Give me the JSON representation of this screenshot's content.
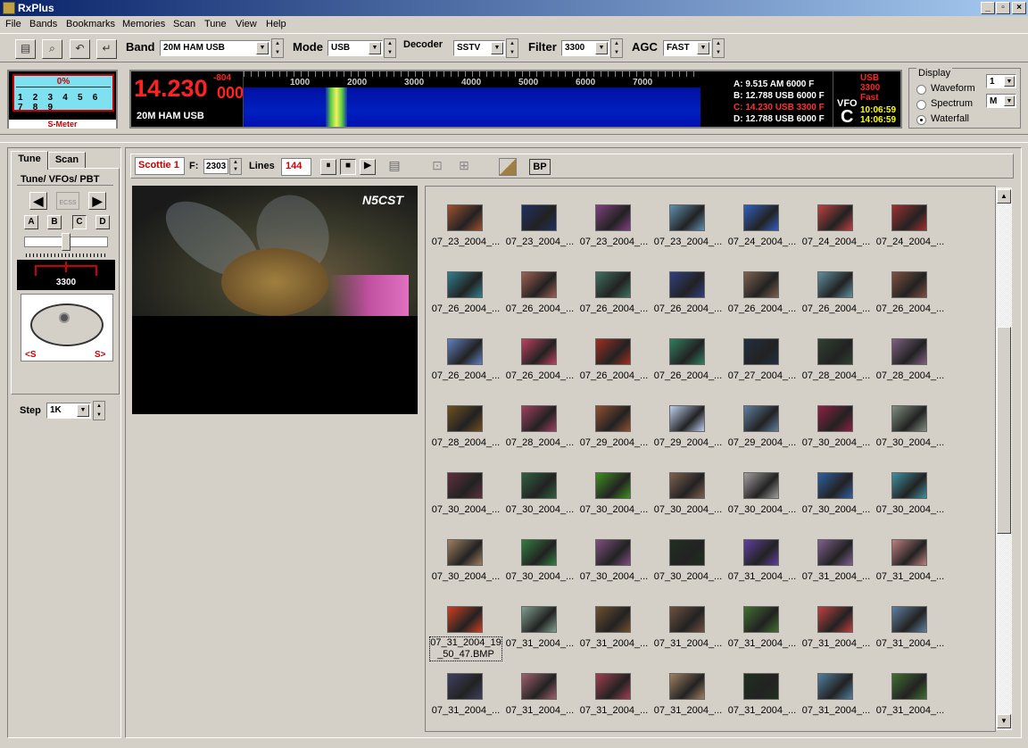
{
  "window": {
    "title": "RxPlus"
  },
  "menu": [
    "File",
    "Bands",
    "Bookmarks",
    "Memories",
    "Scan",
    "Tune",
    "View",
    "Help"
  ],
  "toolbar": {
    "band_label": "Band",
    "band_value": "20M HAM USB",
    "mode_label": "Mode",
    "mode_value": "USB",
    "decoder_label": "Decoder",
    "decoder_value": "SSTV",
    "filter_label": "Filter",
    "filter_value": "3300",
    "agc_label": "AGC",
    "agc_value": "FAST"
  },
  "smeter": {
    "percent": "0%",
    "scale": "1 2 3 4 5 6 7 8 9",
    "label": "S-Meter"
  },
  "frequency": {
    "main": "14.230",
    "sub": "000",
    "offset": "-804",
    "band": "20M HAM USB"
  },
  "spectrum": {
    "ticks": [
      "1000",
      "2000",
      "3000",
      "4000",
      "5000",
      "6000",
      "7000"
    ]
  },
  "vfos": [
    {
      "text": "A: 9.515 AM  6000 F",
      "color": "#ffffff"
    },
    {
      "text": "B: 12.788 USB 6000 F",
      "color": "#ffffff"
    },
    {
      "text": "C: 14.230 USB 3300 F",
      "color": "#ff3030"
    },
    {
      "text": "D: 12.788 USB 6000 F",
      "color": "#ffffff"
    }
  ],
  "vfo": {
    "label": "VFO",
    "letter": "C",
    "mode": "USB",
    "filter": "3300",
    "agc": "Fast",
    "time1": "10:06:59",
    "time2": "14:06:59"
  },
  "display": {
    "label": "Display",
    "options": [
      "Waveform",
      "Spectrum",
      "Waterfall"
    ],
    "selected": "Waterfall",
    "combo1": "1",
    "combo2": "M"
  },
  "tabs": {
    "tune": "Tune",
    "scan": "Scan"
  },
  "tune_panel": {
    "group_label": "Tune/ VFOs/ PBT",
    "ecss_label": "ECSS",
    "vfo_buttons": [
      "A",
      "B",
      "C",
      "D"
    ],
    "pbt_value": "3300",
    "knob_left": "<S",
    "knob_right": "S>",
    "step_label": "Step",
    "step_value": "1K"
  },
  "sstv": {
    "mode": "Scottie 1",
    "f_label": "F:",
    "f_value": "2303",
    "lines_label": "Lines",
    "lines_value": "144",
    "bp_label": "BP",
    "callsign": "N5CST"
  },
  "gallery": {
    "rows": [
      [
        "07_23_2004_...",
        "07_23_2004_...",
        "07_23_2004_...",
        "07_23_2004_...",
        "07_24_2004_...",
        "07_24_2004_...",
        "07_24_2004_..."
      ],
      [
        "07_26_2004_...",
        "07_26_2004_...",
        "07_26_2004_...",
        "07_26_2004_...",
        "07_26_2004_...",
        "07_26_2004_...",
        "07_26_2004_..."
      ],
      [
        "07_26_2004_...",
        "07_26_2004_...",
        "07_26_2004_...",
        "07_26_2004_...",
        "07_27_2004_...",
        "07_28_2004_...",
        "07_28_2004_..."
      ],
      [
        "07_28_2004_...",
        "07_28_2004_...",
        "07_29_2004_...",
        "07_29_2004_...",
        "07_29_2004_...",
        "07_30_2004_...",
        "07_30_2004_..."
      ],
      [
        "07_30_2004_...",
        "07_30_2004_...",
        "07_30_2004_...",
        "07_30_2004_...",
        "07_30_2004_...",
        "07_30_2004_...",
        "07_30_2004_..."
      ],
      [
        "07_30_2004_...",
        "07_30_2004_...",
        "07_30_2004_...",
        "07_30_2004_...",
        "07_31_2004_...",
        "07_31_2004_...",
        "07_31_2004_..."
      ],
      [
        "07_31_2004_19_50_47.BMP",
        "07_31_2004_...",
        "07_31_2004_...",
        "07_31_2004_...",
        "07_31_2004_...",
        "07_31_2004_...",
        "07_31_2004_..."
      ],
      [
        "07_31_2004_...",
        "07_31_2004_...",
        "07_31_2004_...",
        "07_31_2004_...",
        "07_31_2004_...",
        "07_31_2004_...",
        "07_31_2004_..."
      ]
    ],
    "colors": [
      "#a05030",
      "#203060",
      "#804080",
      "#6090b0",
      "#3060c0",
      "#c04040",
      "#a03030",
      "#308090",
      "#a06050",
      "#407060",
      "#304080",
      "#806050",
      "#6090a0",
      "#805040",
      "#6080c0",
      "#c04060",
      "#a03020",
      "#308060",
      "#203040",
      "#304030",
      "#806080",
      "#705020",
      "#a04060",
      "#905030",
      "#c0d0f0",
      "#6080a0",
      "#902040",
      "#809080",
      "#603040",
      "#306040",
      "#409020",
      "#806050",
      "#a0a0a0",
      "#3060a0",
      "#4090a0",
      "#a08060",
      "#308040",
      "#805080",
      "#203020",
      "#6040a0",
      "#806090",
      "#c08080",
      "#d04020",
      "#80a090",
      "#705030",
      "#705040",
      "#407030",
      "#c04040",
      "#6080a0",
      "#404060",
      "#a06070",
      "#a04050",
      "#a08060",
      "#203020",
      "#5080a0",
      "#407030"
    ]
  }
}
